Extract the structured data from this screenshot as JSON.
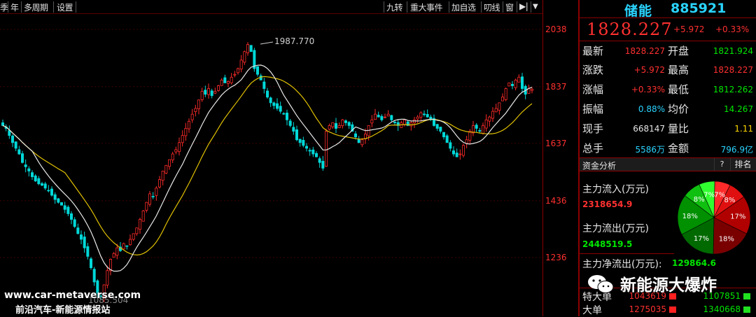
{
  "toolbar": {
    "left_items": [
      "季",
      "年",
      "多周期",
      "设置"
    ],
    "right_items": [
      "九转",
      "重大事件",
      "加自选",
      "叨线",
      "窗",
      "▶|",
      "▼"
    ]
  },
  "chart_data": {
    "type": "candlestick",
    "y_ticks": [
      "2038",
      "1837",
      "1637",
      "1436",
      "1236"
    ],
    "ylim": [
      1050,
      2110
    ],
    "peak_label": "1987.770",
    "low_label": "1085.504",
    "series": [
      {
        "name": "MA short",
        "color": "#e8e8e8"
      },
      {
        "name": "MA long",
        "color": "#e0c000"
      }
    ],
    "closes": [
      1700,
      1690,
      1665,
      1640,
      1620,
      1600,
      1570,
      1555,
      1540,
      1520,
      1505,
      1495,
      1490,
      1480,
      1470,
      1455,
      1440,
      1430,
      1420,
      1405,
      1390,
      1370,
      1345,
      1320,
      1300,
      1270,
      1240,
      1200,
      1150,
      1110,
      1100,
      1140,
      1190,
      1230,
      1250,
      1270,
      1260,
      1285,
      1275,
      1300,
      1320,
      1340,
      1370,
      1400,
      1430,
      1460,
      1450,
      1480,
      1510,
      1540,
      1560,
      1580,
      1600,
      1615,
      1640,
      1665,
      1690,
      1715,
      1740,
      1760,
      1790,
      1820,
      1810,
      1830,
      1805,
      1820,
      1840,
      1860,
      1850,
      1855,
      1870,
      1880,
      1900,
      1930,
      1960,
      1985,
      1960,
      1900,
      1880,
      1860,
      1830,
      1800,
      1780,
      1770,
      1760,
      1750,
      1740,
      1720,
      1700,
      1680,
      1650,
      1640,
      1630,
      1620,
      1610,
      1600,
      1590,
      1570,
      1550,
      1680,
      1700,
      1710,
      1690,
      1700,
      1720,
      1710,
      1700,
      1680,
      1660,
      1640,
      1650,
      1670,
      1700,
      1720,
      1740,
      1730,
      1720,
      1730,
      1740,
      1720,
      1710,
      1700,
      1710,
      1720,
      1700,
      1710,
      1720,
      1730,
      1745,
      1740,
      1730,
      1720,
      1700,
      1690,
      1680,
      1660,
      1640,
      1620,
      1600,
      1590,
      1600,
      1630,
      1650,
      1680,
      1700,
      1690,
      1680,
      1700,
      1720,
      1730,
      1750,
      1760,
      1780,
      1800,
      1830,
      1850,
      1840,
      1860,
      1870,
      1830,
      1810,
      1830,
      1828
    ]
  },
  "panel": {
    "stock_name": "储能",
    "stock_code": "885921",
    "price": "1828.227",
    "change": "+5.972",
    "change_pct": "+0.33%",
    "quotes": [
      {
        "l1": "最新",
        "v1": "1828.227",
        "c1": "red",
        "l2": "开盘",
        "v2": "1821.924",
        "c2": "green"
      },
      {
        "l1": "涨跌",
        "v1": "+5.972",
        "c1": "red",
        "l2": "最高",
        "v2": "1828.227",
        "c2": "red"
      },
      {
        "l1": "涨幅",
        "v1": "+0.33%",
        "c1": "red",
        "l2": "最低",
        "v2": "1812.262",
        "c2": "green"
      },
      {
        "l1": "振幅",
        "v1": "0.88%",
        "c1": "cyan",
        "l2": "均价",
        "v2": "14.267",
        "c2": "green"
      },
      {
        "l1": "现手",
        "v1": "668147",
        "c1": "white",
        "l2": "量比",
        "v2": "1.11",
        "c2": "yellow"
      },
      {
        "l1": "总手",
        "v1": "5586万",
        "c1": "cyan",
        "l2": "金额",
        "v2": "796.9亿",
        "c2": "cyan"
      }
    ],
    "fund": {
      "title": "资金分析",
      "help": "?",
      "rank": "排名",
      "inflow_label": "主力流入(万元)",
      "inflow_value": "2318654.9",
      "outflow_label": "主力流出(万元)",
      "outflow_value": "2448519.5",
      "net_label": "主力净流出(万元):",
      "net_value": "129864.6",
      "pie_slices": [
        {
          "label": "7%",
          "value": 7,
          "color": "#ff2a2a"
        },
        {
          "label": "8%",
          "value": 8,
          "color": "#e01010"
        },
        {
          "label": "17%",
          "value": 17,
          "color": "#b00000"
        },
        {
          "label": "18%",
          "value": 18,
          "color": "#7a0000"
        },
        {
          "label": "17%",
          "value": 17,
          "color": "#006a00"
        },
        {
          "label": "18%",
          "value": 18,
          "color": "#009000"
        },
        {
          "label": "8%",
          "value": 8,
          "color": "#10c010"
        },
        {
          "label": "7%",
          "value": 7,
          "color": "#30ff30"
        }
      ],
      "orders": [
        {
          "label": "特大单",
          "buy": "1043619",
          "sell": "1107851"
        },
        {
          "label": "大单",
          "buy": "1275035",
          "sell": "1340668"
        }
      ]
    }
  },
  "watermark": {
    "wechat": "新能源大爆炸",
    "url": "www.car-metaverse.com",
    "site": "前沿汽车-新能源情报站"
  }
}
